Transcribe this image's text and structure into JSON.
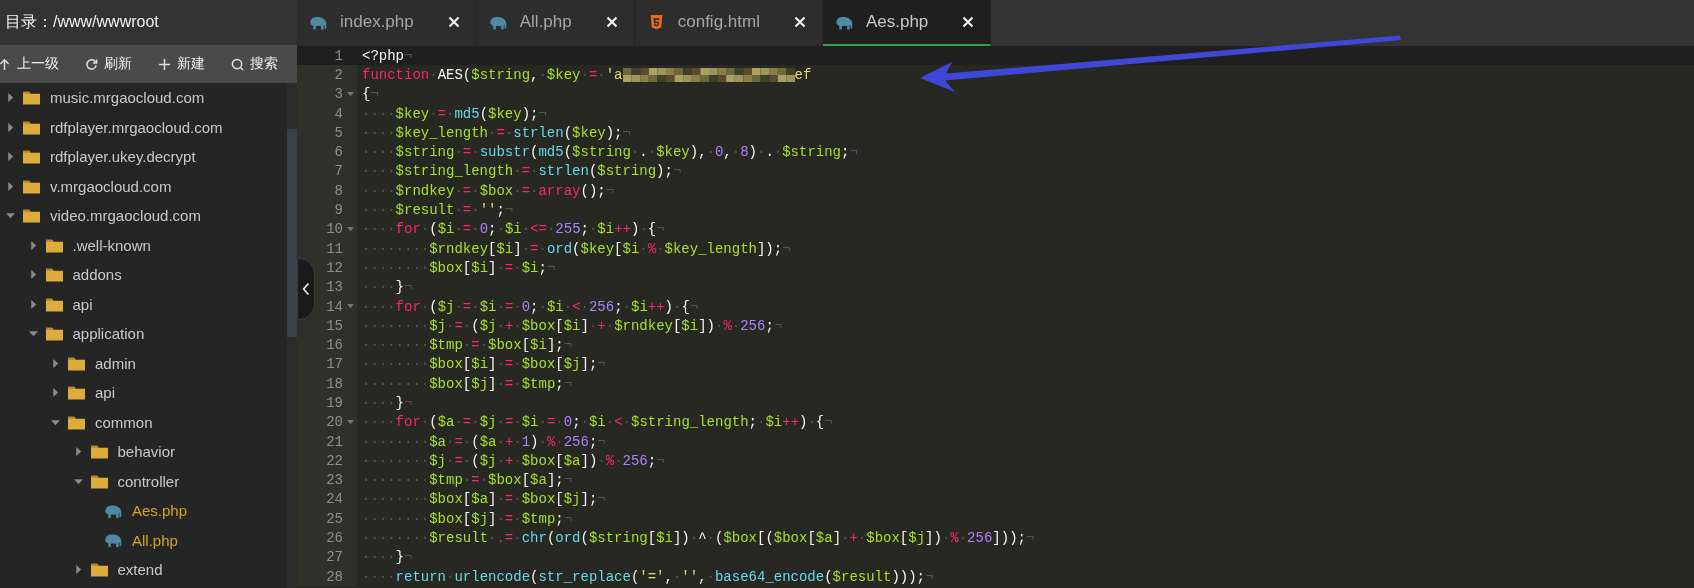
{
  "sidebar": {
    "title": "目录：/www/wwwroot",
    "toolbar": [
      {
        "kind": "up",
        "label": "上一级"
      },
      {
        "kind": "refresh",
        "label": "刷新"
      },
      {
        "kind": "new",
        "label": "新建"
      },
      {
        "kind": "search",
        "label": "搜索"
      }
    ],
    "tree": [
      {
        "kind": "folder",
        "label": "music.mrgaocloud.com",
        "expanded": false
      },
      {
        "kind": "folder",
        "label": "rdfplayer.mrgaocloud.com",
        "expanded": false
      },
      {
        "kind": "folder",
        "label": "rdfplayer.ukey.decrypt",
        "expanded": false
      },
      {
        "kind": "folder",
        "label": "v.mrgaocloud.com",
        "expanded": false
      },
      {
        "kind": "folder",
        "label": "video.mrgaocloud.com",
        "expanded": true,
        "children": [
          {
            "kind": "folder",
            "label": ".well-known",
            "expanded": false
          },
          {
            "kind": "folder",
            "label": "addons",
            "expanded": false
          },
          {
            "kind": "folder",
            "label": "api",
            "expanded": false
          },
          {
            "kind": "folder",
            "label": "application",
            "expanded": true,
            "children": [
              {
                "kind": "folder",
                "label": "admin",
                "expanded": false
              },
              {
                "kind": "folder",
                "label": "api",
                "expanded": false
              },
              {
                "kind": "folder",
                "label": "common",
                "expanded": true,
                "children": [
                  {
                    "kind": "folder",
                    "label": "behavior",
                    "expanded": false
                  },
                  {
                    "kind": "folder",
                    "label": "controller",
                    "expanded": true,
                    "children": [
                      {
                        "kind": "file",
                        "label": "Aes.php"
                      },
                      {
                        "kind": "file",
                        "label": "All.php"
                      }
                    ]
                  },
                  {
                    "kind": "folder",
                    "label": "extend",
                    "expanded": false
                  }
                ]
              }
            ]
          }
        ]
      }
    ]
  },
  "tabs": [
    {
      "kind": "php",
      "label": "index.php",
      "selected": false
    },
    {
      "kind": "php",
      "label": "All.php",
      "selected": false
    },
    {
      "kind": "html",
      "label": "config.html",
      "selected": false
    },
    {
      "kind": "php",
      "label": "Aes.php",
      "selected": true
    }
  ],
  "editor": {
    "lines": [
      {
        "number": "1",
        "active": true,
        "foldable": false,
        "tokens": [
          {
            "kind": "p",
            "text": "<?php"
          },
          {
            "kind": "e",
            "text": "¬"
          }
        ]
      },
      {
        "number": "2",
        "active": false,
        "foldable": false,
        "tokens": [
          {
            "kind": "k",
            "text": "function"
          },
          {
            "kind": "w",
            "text": "·"
          },
          {
            "kind": "p",
            "text": "AES("
          },
          {
            "kind": "v",
            "text": "$string"
          },
          {
            "kind": "p",
            "text": ","
          },
          {
            "kind": "w",
            "text": "·"
          },
          {
            "kind": "v",
            "text": "$key"
          },
          {
            "kind": "w",
            "text": "·"
          },
          {
            "kind": "o",
            "text": "="
          },
          {
            "kind": "w",
            "text": "·"
          },
          {
            "kind": "s",
            "text": "'a"
          },
          {
            "kind": "redacted"
          },
          {
            "kind": "s",
            "text": "ef"
          }
        ]
      },
      {
        "number": "3",
        "active": false,
        "foldable": true,
        "tokens": [
          {
            "kind": "p",
            "text": "{"
          },
          {
            "kind": "e",
            "text": "¬"
          }
        ]
      },
      {
        "number": "4",
        "active": false,
        "foldable": false,
        "tokens": [
          {
            "kind": "w",
            "text": "····"
          },
          {
            "kind": "v",
            "text": "$key"
          },
          {
            "kind": "w",
            "text": "·"
          },
          {
            "kind": "o",
            "text": "="
          },
          {
            "kind": "w",
            "text": "·"
          },
          {
            "kind": "f",
            "text": "md5"
          },
          {
            "kind": "p",
            "text": "("
          },
          {
            "kind": "v",
            "text": "$key"
          },
          {
            "kind": "p",
            "text": ");"
          },
          {
            "kind": "e",
            "text": "¬"
          }
        ]
      },
      {
        "number": "5",
        "active": false,
        "foldable": false,
        "tokens": [
          {
            "kind": "w",
            "text": "····"
          },
          {
            "kind": "v",
            "text": "$key_length"
          },
          {
            "kind": "w",
            "text": "·"
          },
          {
            "kind": "o",
            "text": "="
          },
          {
            "kind": "w",
            "text": "·"
          },
          {
            "kind": "f",
            "text": "strlen"
          },
          {
            "kind": "p",
            "text": "("
          },
          {
            "kind": "v",
            "text": "$key"
          },
          {
            "kind": "p",
            "text": ");"
          },
          {
            "kind": "e",
            "text": "¬"
          }
        ]
      },
      {
        "number": "6",
        "active": false,
        "foldable": false,
        "tokens": [
          {
            "kind": "w",
            "text": "····"
          },
          {
            "kind": "v",
            "text": "$string"
          },
          {
            "kind": "w",
            "text": "·"
          },
          {
            "kind": "o",
            "text": "="
          },
          {
            "kind": "w",
            "text": "·"
          },
          {
            "kind": "f",
            "text": "substr"
          },
          {
            "kind": "p",
            "text": "("
          },
          {
            "kind": "f",
            "text": "md5"
          },
          {
            "kind": "p",
            "text": "("
          },
          {
            "kind": "v",
            "text": "$string"
          },
          {
            "kind": "w",
            "text": "·"
          },
          {
            "kind": "p",
            "text": "."
          },
          {
            "kind": "w",
            "text": "·"
          },
          {
            "kind": "v",
            "text": "$key"
          },
          {
            "kind": "p",
            "text": "),"
          },
          {
            "kind": "w",
            "text": "·"
          },
          {
            "kind": "n",
            "text": "0"
          },
          {
            "kind": "p",
            "text": ","
          },
          {
            "kind": "w",
            "text": "·"
          },
          {
            "kind": "n",
            "text": "8"
          },
          {
            "kind": "p",
            "text": ")"
          },
          {
            "kind": "w",
            "text": "·"
          },
          {
            "kind": "p",
            "text": "."
          },
          {
            "kind": "w",
            "text": "·"
          },
          {
            "kind": "v",
            "text": "$string"
          },
          {
            "kind": "p",
            "text": ";"
          },
          {
            "kind": "e",
            "text": "¬"
          }
        ]
      },
      {
        "number": "7",
        "active": false,
        "foldable": false,
        "tokens": [
          {
            "kind": "w",
            "text": "····"
          },
          {
            "kind": "v",
            "text": "$string_length"
          },
          {
            "kind": "w",
            "text": "·"
          },
          {
            "kind": "o",
            "text": "="
          },
          {
            "kind": "w",
            "text": "·"
          },
          {
            "kind": "f",
            "text": "strlen"
          },
          {
            "kind": "p",
            "text": "("
          },
          {
            "kind": "v",
            "text": "$string"
          },
          {
            "kind": "p",
            "text": ");"
          },
          {
            "kind": "e",
            "text": "¬"
          }
        ]
      },
      {
        "number": "8",
        "active": false,
        "foldable": false,
        "tokens": [
          {
            "kind": "w",
            "text": "····"
          },
          {
            "kind": "v",
            "text": "$rndkey"
          },
          {
            "kind": "w",
            "text": "·"
          },
          {
            "kind": "o",
            "text": "="
          },
          {
            "kind": "w",
            "text": "·"
          },
          {
            "kind": "v",
            "text": "$box"
          },
          {
            "kind": "w",
            "text": "·"
          },
          {
            "kind": "o",
            "text": "="
          },
          {
            "kind": "w",
            "text": "·"
          },
          {
            "kind": "k",
            "text": "array"
          },
          {
            "kind": "p",
            "text": "();"
          },
          {
            "kind": "e",
            "text": "¬"
          }
        ]
      },
      {
        "number": "9",
        "active": false,
        "foldable": false,
        "tokens": [
          {
            "kind": "w",
            "text": "····"
          },
          {
            "kind": "v",
            "text": "$result"
          },
          {
            "kind": "w",
            "text": "·"
          },
          {
            "kind": "o",
            "text": "="
          },
          {
            "kind": "w",
            "text": "·"
          },
          {
            "kind": "s",
            "text": "''"
          },
          {
            "kind": "p",
            "text": ";"
          },
          {
            "kind": "e",
            "text": "¬"
          }
        ]
      },
      {
        "number": "10",
        "active": false,
        "foldable": true,
        "tokens": [
          {
            "kind": "w",
            "text": "····"
          },
          {
            "kind": "k",
            "text": "for"
          },
          {
            "kind": "w",
            "text": "·"
          },
          {
            "kind": "p",
            "text": "("
          },
          {
            "kind": "v",
            "text": "$i"
          },
          {
            "kind": "w",
            "text": "·"
          },
          {
            "kind": "o",
            "text": "="
          },
          {
            "kind": "w",
            "text": "·"
          },
          {
            "kind": "n",
            "text": "0"
          },
          {
            "kind": "p",
            "text": ";"
          },
          {
            "kind": "w",
            "text": "·"
          },
          {
            "kind": "v",
            "text": "$i"
          },
          {
            "kind": "w",
            "text": "·"
          },
          {
            "kind": "o",
            "text": "<="
          },
          {
            "kind": "w",
            "text": "·"
          },
          {
            "kind": "n",
            "text": "255"
          },
          {
            "kind": "p",
            "text": ";"
          },
          {
            "kind": "w",
            "text": "·"
          },
          {
            "kind": "v",
            "text": "$i"
          },
          {
            "kind": "o",
            "text": "++"
          },
          {
            "kind": "p",
            "text": ")"
          },
          {
            "kind": "w",
            "text": "·"
          },
          {
            "kind": "p",
            "text": "{"
          },
          {
            "kind": "e",
            "text": "¬"
          }
        ]
      },
      {
        "number": "11",
        "active": false,
        "foldable": false,
        "tokens": [
          {
            "kind": "w",
            "text": "········"
          },
          {
            "kind": "v",
            "text": "$rndkey"
          },
          {
            "kind": "p",
            "text": "["
          },
          {
            "kind": "v",
            "text": "$i"
          },
          {
            "kind": "p",
            "text": "]"
          },
          {
            "kind": "w",
            "text": "·"
          },
          {
            "kind": "o",
            "text": "="
          },
          {
            "kind": "w",
            "text": "·"
          },
          {
            "kind": "f",
            "text": "ord"
          },
          {
            "kind": "p",
            "text": "("
          },
          {
            "kind": "v",
            "text": "$key"
          },
          {
            "kind": "p",
            "text": "["
          },
          {
            "kind": "v",
            "text": "$i"
          },
          {
            "kind": "w",
            "text": "·"
          },
          {
            "kind": "o",
            "text": "%"
          },
          {
            "kind": "w",
            "text": "·"
          },
          {
            "kind": "v",
            "text": "$key_length"
          },
          {
            "kind": "p",
            "text": "]);"
          },
          {
            "kind": "e",
            "text": "¬"
          }
        ]
      },
      {
        "number": "12",
        "active": false,
        "foldable": false,
        "tokens": [
          {
            "kind": "w",
            "text": "········"
          },
          {
            "kind": "v",
            "text": "$box"
          },
          {
            "kind": "p",
            "text": "["
          },
          {
            "kind": "v",
            "text": "$i"
          },
          {
            "kind": "p",
            "text": "]"
          },
          {
            "kind": "w",
            "text": "·"
          },
          {
            "kind": "o",
            "text": "="
          },
          {
            "kind": "w",
            "text": "·"
          },
          {
            "kind": "v",
            "text": "$i"
          },
          {
            "kind": "p",
            "text": ";"
          },
          {
            "kind": "e",
            "text": "¬"
          }
        ]
      },
      {
        "number": "13",
        "active": false,
        "foldable": false,
        "tokens": [
          {
            "kind": "w",
            "text": "····"
          },
          {
            "kind": "p",
            "text": "}"
          },
          {
            "kind": "e",
            "text": "¬"
          }
        ]
      },
      {
        "number": "14",
        "active": false,
        "foldable": true,
        "tokens": [
          {
            "kind": "w",
            "text": "····"
          },
          {
            "kind": "k",
            "text": "for"
          },
          {
            "kind": "w",
            "text": "·"
          },
          {
            "kind": "p",
            "text": "("
          },
          {
            "kind": "v",
            "text": "$j"
          },
          {
            "kind": "w",
            "text": "·"
          },
          {
            "kind": "o",
            "text": "="
          },
          {
            "kind": "w",
            "text": "·"
          },
          {
            "kind": "v",
            "text": "$i"
          },
          {
            "kind": "w",
            "text": "·"
          },
          {
            "kind": "o",
            "text": "="
          },
          {
            "kind": "w",
            "text": "·"
          },
          {
            "kind": "n",
            "text": "0"
          },
          {
            "kind": "p",
            "text": ";"
          },
          {
            "kind": "w",
            "text": "·"
          },
          {
            "kind": "v",
            "text": "$i"
          },
          {
            "kind": "w",
            "text": "·"
          },
          {
            "kind": "o",
            "text": "<"
          },
          {
            "kind": "w",
            "text": "·"
          },
          {
            "kind": "n",
            "text": "256"
          },
          {
            "kind": "p",
            "text": ";"
          },
          {
            "kind": "w",
            "text": "·"
          },
          {
            "kind": "v",
            "text": "$i"
          },
          {
            "kind": "o",
            "text": "++"
          },
          {
            "kind": "p",
            "text": ")"
          },
          {
            "kind": "w",
            "text": "·"
          },
          {
            "kind": "p",
            "text": "{"
          },
          {
            "kind": "e",
            "text": "¬"
          }
        ]
      },
      {
        "number": "15",
        "active": false,
        "foldable": false,
        "tokens": [
          {
            "kind": "w",
            "text": "········"
          },
          {
            "kind": "v",
            "text": "$j"
          },
          {
            "kind": "w",
            "text": "·"
          },
          {
            "kind": "o",
            "text": "="
          },
          {
            "kind": "w",
            "text": "·"
          },
          {
            "kind": "p",
            "text": "("
          },
          {
            "kind": "v",
            "text": "$j"
          },
          {
            "kind": "w",
            "text": "·"
          },
          {
            "kind": "o",
            "text": "+"
          },
          {
            "kind": "w",
            "text": "·"
          },
          {
            "kind": "v",
            "text": "$box"
          },
          {
            "kind": "p",
            "text": "["
          },
          {
            "kind": "v",
            "text": "$i"
          },
          {
            "kind": "p",
            "text": "]"
          },
          {
            "kind": "w",
            "text": "·"
          },
          {
            "kind": "o",
            "text": "+"
          },
          {
            "kind": "w",
            "text": "·"
          },
          {
            "kind": "v",
            "text": "$rndkey"
          },
          {
            "kind": "p",
            "text": "["
          },
          {
            "kind": "v",
            "text": "$i"
          },
          {
            "kind": "p",
            "text": "])"
          },
          {
            "kind": "w",
            "text": "·"
          },
          {
            "kind": "o",
            "text": "%"
          },
          {
            "kind": "w",
            "text": "·"
          },
          {
            "kind": "n",
            "text": "256"
          },
          {
            "kind": "p",
            "text": ";"
          },
          {
            "kind": "e",
            "text": "¬"
          }
        ]
      },
      {
        "number": "16",
        "active": false,
        "foldable": false,
        "tokens": [
          {
            "kind": "w",
            "text": "········"
          },
          {
            "kind": "v",
            "text": "$tmp"
          },
          {
            "kind": "w",
            "text": "·"
          },
          {
            "kind": "o",
            "text": "="
          },
          {
            "kind": "w",
            "text": "·"
          },
          {
            "kind": "v",
            "text": "$box"
          },
          {
            "kind": "p",
            "text": "["
          },
          {
            "kind": "v",
            "text": "$i"
          },
          {
            "kind": "p",
            "text": "];"
          },
          {
            "kind": "e",
            "text": "¬"
          }
        ]
      },
      {
        "number": "17",
        "active": false,
        "foldable": false,
        "tokens": [
          {
            "kind": "w",
            "text": "········"
          },
          {
            "kind": "v",
            "text": "$box"
          },
          {
            "kind": "p",
            "text": "["
          },
          {
            "kind": "v",
            "text": "$i"
          },
          {
            "kind": "p",
            "text": "]"
          },
          {
            "kind": "w",
            "text": "·"
          },
          {
            "kind": "o",
            "text": "="
          },
          {
            "kind": "w",
            "text": "·"
          },
          {
            "kind": "v",
            "text": "$box"
          },
          {
            "kind": "p",
            "text": "["
          },
          {
            "kind": "v",
            "text": "$j"
          },
          {
            "kind": "p",
            "text": "];"
          },
          {
            "kind": "e",
            "text": "¬"
          }
        ]
      },
      {
        "number": "18",
        "active": false,
        "foldable": false,
        "tokens": [
          {
            "kind": "w",
            "text": "········"
          },
          {
            "kind": "v",
            "text": "$box"
          },
          {
            "kind": "p",
            "text": "["
          },
          {
            "kind": "v",
            "text": "$j"
          },
          {
            "kind": "p",
            "text": "]"
          },
          {
            "kind": "w",
            "text": "·"
          },
          {
            "kind": "o",
            "text": "="
          },
          {
            "kind": "w",
            "text": "·"
          },
          {
            "kind": "v",
            "text": "$tmp"
          },
          {
            "kind": "p",
            "text": ";"
          },
          {
            "kind": "e",
            "text": "¬"
          }
        ]
      },
      {
        "number": "19",
        "active": false,
        "foldable": false,
        "tokens": [
          {
            "kind": "w",
            "text": "····"
          },
          {
            "kind": "p",
            "text": "}"
          },
          {
            "kind": "e",
            "text": "¬"
          }
        ]
      },
      {
        "number": "20",
        "active": false,
        "foldable": true,
        "tokens": [
          {
            "kind": "w",
            "text": "····"
          },
          {
            "kind": "k",
            "text": "for"
          },
          {
            "kind": "w",
            "text": "·"
          },
          {
            "kind": "p",
            "text": "("
          },
          {
            "kind": "v",
            "text": "$a"
          },
          {
            "kind": "w",
            "text": "·"
          },
          {
            "kind": "o",
            "text": "="
          },
          {
            "kind": "w",
            "text": "·"
          },
          {
            "kind": "v",
            "text": "$j"
          },
          {
            "kind": "w",
            "text": "·"
          },
          {
            "kind": "o",
            "text": "="
          },
          {
            "kind": "w",
            "text": "·"
          },
          {
            "kind": "v",
            "text": "$i"
          },
          {
            "kind": "w",
            "text": "·"
          },
          {
            "kind": "o",
            "text": "="
          },
          {
            "kind": "w",
            "text": "·"
          },
          {
            "kind": "n",
            "text": "0"
          },
          {
            "kind": "p",
            "text": ";"
          },
          {
            "kind": "w",
            "text": "·"
          },
          {
            "kind": "v",
            "text": "$i"
          },
          {
            "kind": "w",
            "text": "·"
          },
          {
            "kind": "o",
            "text": "<"
          },
          {
            "kind": "w",
            "text": "·"
          },
          {
            "kind": "v",
            "text": "$string_length"
          },
          {
            "kind": "p",
            "text": ";"
          },
          {
            "kind": "w",
            "text": "·"
          },
          {
            "kind": "v",
            "text": "$i"
          },
          {
            "kind": "o",
            "text": "++"
          },
          {
            "kind": "p",
            "text": ")"
          },
          {
            "kind": "w",
            "text": "·"
          },
          {
            "kind": "p",
            "text": "{"
          },
          {
            "kind": "e",
            "text": "¬"
          }
        ]
      },
      {
        "number": "21",
        "active": false,
        "foldable": false,
        "tokens": [
          {
            "kind": "w",
            "text": "········"
          },
          {
            "kind": "v",
            "text": "$a"
          },
          {
            "kind": "w",
            "text": "·"
          },
          {
            "kind": "o",
            "text": "="
          },
          {
            "kind": "w",
            "text": "·"
          },
          {
            "kind": "p",
            "text": "("
          },
          {
            "kind": "v",
            "text": "$a"
          },
          {
            "kind": "w",
            "text": "·"
          },
          {
            "kind": "o",
            "text": "+"
          },
          {
            "kind": "w",
            "text": "·"
          },
          {
            "kind": "n",
            "text": "1"
          },
          {
            "kind": "p",
            "text": ")"
          },
          {
            "kind": "w",
            "text": "·"
          },
          {
            "kind": "o",
            "text": "%"
          },
          {
            "kind": "w",
            "text": "·"
          },
          {
            "kind": "n",
            "text": "256"
          },
          {
            "kind": "p",
            "text": ";"
          },
          {
            "kind": "e",
            "text": "¬"
          }
        ]
      },
      {
        "number": "22",
        "active": false,
        "foldable": false,
        "tokens": [
          {
            "kind": "w",
            "text": "········"
          },
          {
            "kind": "v",
            "text": "$j"
          },
          {
            "kind": "w",
            "text": "·"
          },
          {
            "kind": "o",
            "text": "="
          },
          {
            "kind": "w",
            "text": "·"
          },
          {
            "kind": "p",
            "text": "("
          },
          {
            "kind": "v",
            "text": "$j"
          },
          {
            "kind": "w",
            "text": "·"
          },
          {
            "kind": "o",
            "text": "+"
          },
          {
            "kind": "w",
            "text": "·"
          },
          {
            "kind": "v",
            "text": "$box"
          },
          {
            "kind": "p",
            "text": "["
          },
          {
            "kind": "v",
            "text": "$a"
          },
          {
            "kind": "p",
            "text": "])"
          },
          {
            "kind": "w",
            "text": "·"
          },
          {
            "kind": "o",
            "text": "%"
          },
          {
            "kind": "w",
            "text": "·"
          },
          {
            "kind": "n",
            "text": "256"
          },
          {
            "kind": "p",
            "text": ";"
          },
          {
            "kind": "e",
            "text": "¬"
          }
        ]
      },
      {
        "number": "23",
        "active": false,
        "foldable": false,
        "tokens": [
          {
            "kind": "w",
            "text": "········"
          },
          {
            "kind": "v",
            "text": "$tmp"
          },
          {
            "kind": "w",
            "text": "·"
          },
          {
            "kind": "o",
            "text": "="
          },
          {
            "kind": "w",
            "text": "·"
          },
          {
            "kind": "v",
            "text": "$box"
          },
          {
            "kind": "p",
            "text": "["
          },
          {
            "kind": "v",
            "text": "$a"
          },
          {
            "kind": "p",
            "text": "];"
          },
          {
            "kind": "e",
            "text": "¬"
          }
        ]
      },
      {
        "number": "24",
        "active": false,
        "foldable": false,
        "tokens": [
          {
            "kind": "w",
            "text": "········"
          },
          {
            "kind": "v",
            "text": "$box"
          },
          {
            "kind": "p",
            "text": "["
          },
          {
            "kind": "v",
            "text": "$a"
          },
          {
            "kind": "p",
            "text": "]"
          },
          {
            "kind": "w",
            "text": "·"
          },
          {
            "kind": "o",
            "text": "="
          },
          {
            "kind": "w",
            "text": "·"
          },
          {
            "kind": "v",
            "text": "$box"
          },
          {
            "kind": "p",
            "text": "["
          },
          {
            "kind": "v",
            "text": "$j"
          },
          {
            "kind": "p",
            "text": "];"
          },
          {
            "kind": "e",
            "text": "¬"
          }
        ]
      },
      {
        "number": "25",
        "active": false,
        "foldable": false,
        "tokens": [
          {
            "kind": "w",
            "text": "········"
          },
          {
            "kind": "v",
            "text": "$box"
          },
          {
            "kind": "p",
            "text": "["
          },
          {
            "kind": "v",
            "text": "$j"
          },
          {
            "kind": "p",
            "text": "]"
          },
          {
            "kind": "w",
            "text": "·"
          },
          {
            "kind": "o",
            "text": "="
          },
          {
            "kind": "w",
            "text": "·"
          },
          {
            "kind": "v",
            "text": "$tmp"
          },
          {
            "kind": "p",
            "text": ";"
          },
          {
            "kind": "e",
            "text": "¬"
          }
        ]
      },
      {
        "number": "26",
        "active": false,
        "foldable": false,
        "tokens": [
          {
            "kind": "w",
            "text": "········"
          },
          {
            "kind": "v",
            "text": "$result"
          },
          {
            "kind": "w",
            "text": "·"
          },
          {
            "kind": "o",
            "text": ".="
          },
          {
            "kind": "w",
            "text": "·"
          },
          {
            "kind": "f",
            "text": "chr"
          },
          {
            "kind": "p",
            "text": "("
          },
          {
            "kind": "f",
            "text": "ord"
          },
          {
            "kind": "p",
            "text": "("
          },
          {
            "kind": "v",
            "text": "$string"
          },
          {
            "kind": "p",
            "text": "["
          },
          {
            "kind": "v",
            "text": "$i"
          },
          {
            "kind": "p",
            "text": "])"
          },
          {
            "kind": "w",
            "text": "·"
          },
          {
            "kind": "p",
            "text": "^"
          },
          {
            "kind": "w",
            "text": "·"
          },
          {
            "kind": "p",
            "text": "("
          },
          {
            "kind": "v",
            "text": "$box"
          },
          {
            "kind": "p",
            "text": "[("
          },
          {
            "kind": "v",
            "text": "$box"
          },
          {
            "kind": "p",
            "text": "["
          },
          {
            "kind": "v",
            "text": "$a"
          },
          {
            "kind": "p",
            "text": "]"
          },
          {
            "kind": "w",
            "text": "·"
          },
          {
            "kind": "o",
            "text": "+"
          },
          {
            "kind": "w",
            "text": "·"
          },
          {
            "kind": "v",
            "text": "$box"
          },
          {
            "kind": "p",
            "text": "["
          },
          {
            "kind": "v",
            "text": "$j"
          },
          {
            "kind": "p",
            "text": "])"
          },
          {
            "kind": "w",
            "text": "·"
          },
          {
            "kind": "o",
            "text": "%"
          },
          {
            "kind": "w",
            "text": "·"
          },
          {
            "kind": "n",
            "text": "256"
          },
          {
            "kind": "p",
            "text": "]));"
          },
          {
            "kind": "e",
            "text": "¬"
          }
        ]
      },
      {
        "number": "27",
        "active": false,
        "foldable": false,
        "tokens": [
          {
            "kind": "w",
            "text": "····"
          },
          {
            "kind": "p",
            "text": "}"
          },
          {
            "kind": "e",
            "text": "¬"
          }
        ]
      },
      {
        "number": "28",
        "active": false,
        "foldable": false,
        "tokens": [
          {
            "kind": "w",
            "text": "····"
          },
          {
            "kind": "f",
            "text": "return"
          },
          {
            "kind": "w",
            "text": "·"
          },
          {
            "kind": "f",
            "text": "urlencode"
          },
          {
            "kind": "p",
            "text": "("
          },
          {
            "kind": "f",
            "text": "str_replace"
          },
          {
            "kind": "p",
            "text": "("
          },
          {
            "kind": "s",
            "text": "'='"
          },
          {
            "kind": "p",
            "text": ","
          },
          {
            "kind": "w",
            "text": "·"
          },
          {
            "kind": "s",
            "text": "''"
          },
          {
            "kind": "p",
            "text": ","
          },
          {
            "kind": "w",
            "text": "·"
          },
          {
            "kind": "f",
            "text": "base64_encode"
          },
          {
            "kind": "p",
            "text": "("
          },
          {
            "kind": "v",
            "text": "$result"
          },
          {
            "kind": "p",
            "text": ")));"
          },
          {
            "kind": "e",
            "text": "¬"
          }
        ]
      }
    ]
  }
}
